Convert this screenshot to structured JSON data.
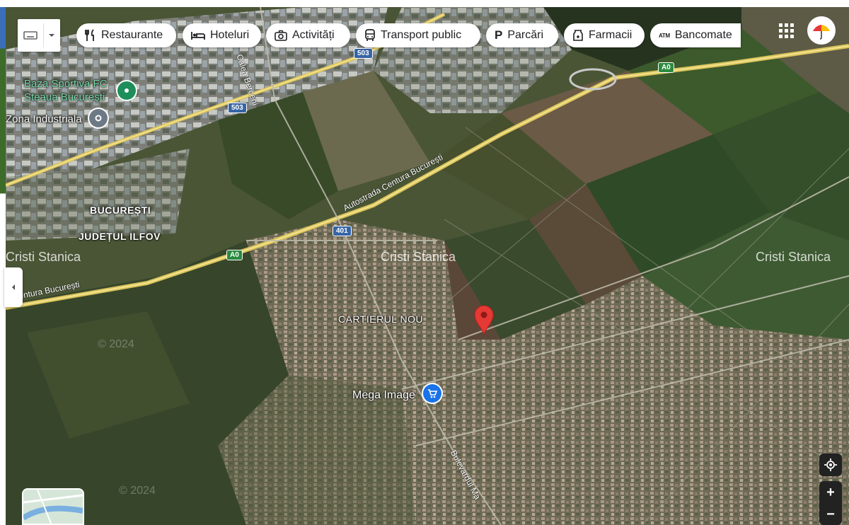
{
  "toolbar": {
    "chips": [
      {
        "label": "Restaurante",
        "icon": "fork-knife-icon"
      },
      {
        "label": "Hoteluri",
        "icon": "bed-icon"
      },
      {
        "label": "Activități",
        "icon": "camera-icon"
      },
      {
        "label": "Transport public",
        "icon": "bus-icon"
      },
      {
        "label": "Parcări",
        "icon": "parking-icon"
      },
      {
        "label": "Farmacii",
        "icon": "pharmacy-icon"
      },
      {
        "label": "Bancomate",
        "icon": "atm-icon"
      }
    ],
    "atm_glyph": "ATM",
    "parking_glyph": "P"
  },
  "map": {
    "places": {
      "baza_line1": "Baza Sportiva FC",
      "baza_line2": "Steaua București",
      "zona": "Zona Industriala",
      "bucuresti": "BUCUREȘTI",
      "judetul": "JUDEȚUL ILFOV",
      "cartierul": "CARTIERUL NOU",
      "mega": "Mega Image"
    },
    "roads": {
      "centura_a": "Autostrada Centura București",
      "centura_b": "Centura București",
      "berceni": "Calea Berceni",
      "bulevardul": "Bulevardul Ma",
      "shield_503a": "503",
      "shield_503b": "503",
      "shield_401": "401",
      "shield_a0a": "A0",
      "shield_a0b": "A0"
    },
    "watermark": "Cristi Stanica",
    "faint": "© 2024"
  },
  "controls": {
    "zoom_in": "+",
    "zoom_out": "−"
  }
}
